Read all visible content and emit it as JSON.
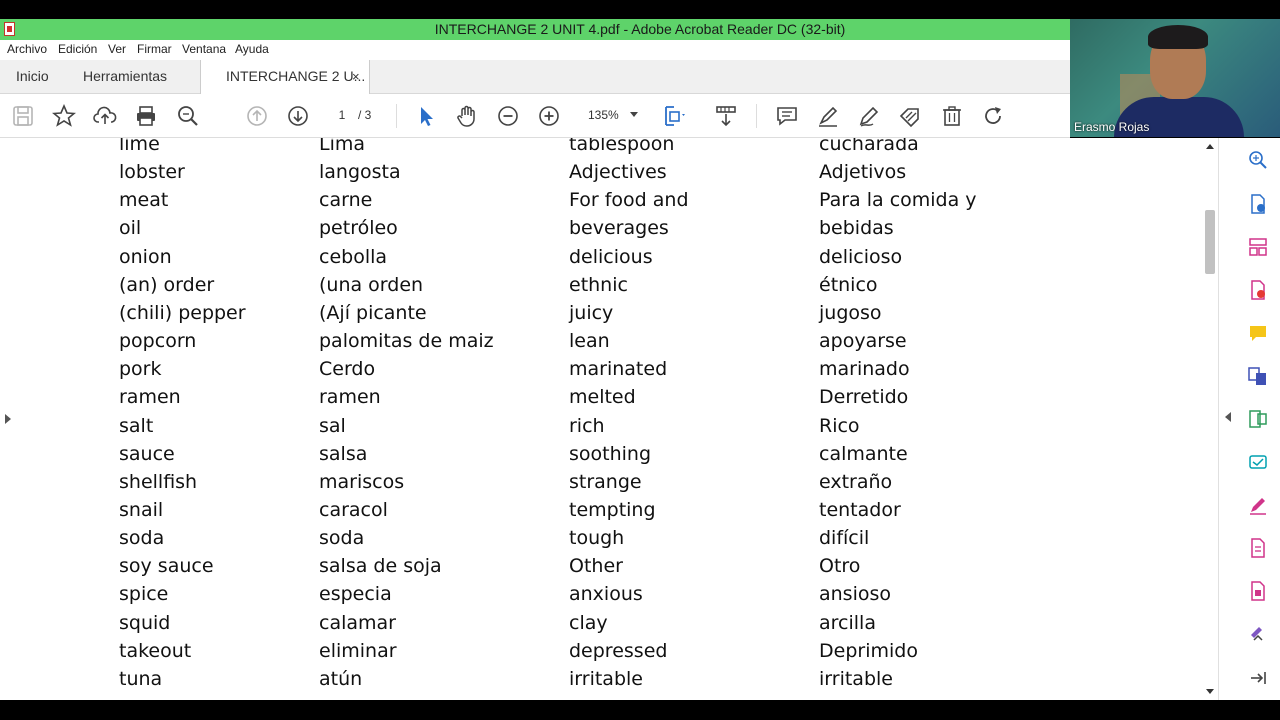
{
  "window": {
    "title": "INTERCHANGE 2 UNIT 4.pdf - Adobe Acrobat Reader DC (32-bit)"
  },
  "menu": [
    "Archivo",
    "Edición",
    "Ver",
    "Firmar",
    "Ventana",
    "Ayuda"
  ],
  "tabs": {
    "home": "Inicio",
    "tools": "Herramientas",
    "document": "INTERCHANGE 2 U...",
    "close": "×"
  },
  "toolbar": {
    "page_current": "1",
    "page_total": "/ 3",
    "zoom": "135%",
    "icons": [
      "save-icon",
      "star-icon",
      "upload-icon",
      "print-icon",
      "search-icon",
      "page-up-icon",
      "page-down-icon",
      "select-cursor-icon",
      "hand-icon",
      "zoom-out-icon",
      "zoom-in-icon",
      "fit-page-icon",
      "scroll-mode-icon",
      "comment-icon",
      "highlight-pen-icon",
      "draw-icon",
      "sign-icon",
      "delete-icon",
      "rotate-icon"
    ]
  },
  "webcam": {
    "name": "Erasmo Rojas"
  },
  "vocabulary": [
    [
      "lime",
      "Lima",
      "tablespoon",
      "cucharada"
    ],
    [
      "lobster",
      "langosta",
      "Adjectives",
      "Adjetivos"
    ],
    [
      "meat",
      "carne",
      "For food and",
      "Para la comida y"
    ],
    [
      "oil",
      "petróleo",
      "beverages",
      "bebidas"
    ],
    [
      "onion",
      "cebolla",
      "delicious",
      "delicioso"
    ],
    [
      "(an) order",
      "(una orden",
      "ethnic",
      "étnico"
    ],
    [
      "(chili) pepper",
      "(Ají picante",
      "juicy",
      "jugoso"
    ],
    [
      "popcorn",
      "palomitas de maiz",
      "lean",
      "apoyarse"
    ],
    [
      "pork",
      "Cerdo",
      "marinated",
      "marinado"
    ],
    [
      "ramen",
      "ramen",
      "melted",
      "Derretido"
    ],
    [
      "salt",
      "sal",
      "rich",
      "Rico"
    ],
    [
      "sauce",
      "salsa",
      "soothing",
      "calmante"
    ],
    [
      "shellfish",
      "mariscos",
      "strange",
      "extraño"
    ],
    [
      "snail",
      "caracol",
      "tempting",
      "tentador"
    ],
    [
      "soda",
      "soda",
      "tough",
      "difícil"
    ],
    [
      "soy sauce",
      "salsa de soja",
      "Other",
      "Otro"
    ],
    [
      "spice",
      "especia",
      "anxious",
      "ansioso"
    ],
    [
      "squid",
      "calamar",
      "clay",
      "arcilla"
    ],
    [
      "takeout",
      "eliminar",
      "depressed",
      "Deprimido"
    ],
    [
      "tuna",
      "atún",
      "irritable",
      "irritable"
    ]
  ],
  "colors": {
    "titlebar": "#5ed36a",
    "accent_blue": "#2b6fc9",
    "tool_pink": "#d0348a",
    "tool_green": "#2e9c5c"
  }
}
